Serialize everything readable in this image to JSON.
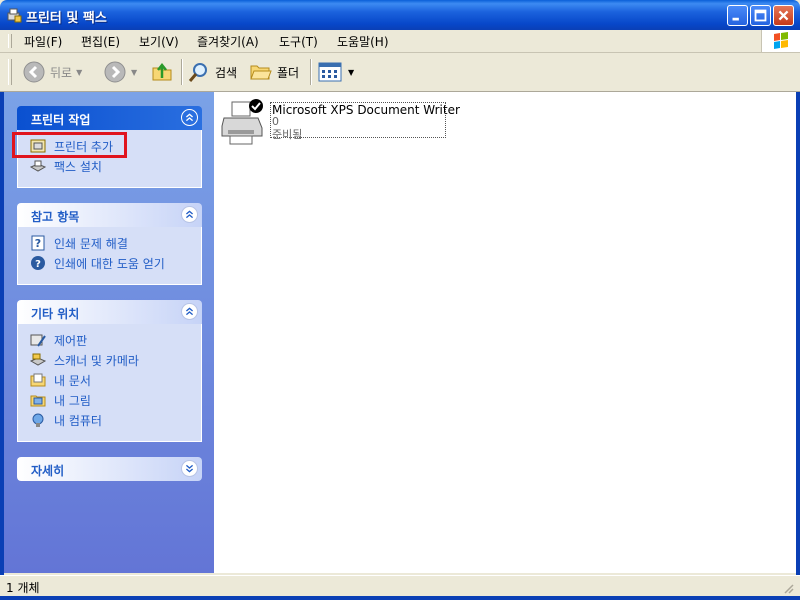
{
  "window": {
    "title": "프린터 및 팩스"
  },
  "menu": {
    "items": [
      "파일(F)",
      "편집(E)",
      "보기(V)",
      "즐겨찾기(A)",
      "도구(T)",
      "도움말(H)"
    ]
  },
  "toolbar": {
    "back": "뒤로",
    "search": "검색",
    "folders": "폴더"
  },
  "task_pane": {
    "printer_tasks": {
      "title": "프린터 작업",
      "items": [
        "프린터 추가",
        "팩스 설치"
      ]
    },
    "see_also": {
      "title": "참고 항목",
      "items": [
        "인쇄 문제 해결",
        "인쇄에 대한 도움 얻기"
      ]
    },
    "other_places": {
      "title": "기타 위치",
      "items": [
        "제어판",
        "스캐너 및 카메라",
        "내 문서",
        "내 그림",
        "내 컴퓨터"
      ]
    },
    "details": {
      "title": "자세히"
    }
  },
  "printer": {
    "name": "Microsoft XPS Document Writer",
    "documents": "0",
    "status": "준비됨"
  },
  "statusbar": {
    "text": "1 개체"
  },
  "colors": {
    "titlebar": "#0a5fd8",
    "taskpane": "#7ba2e7",
    "link": "#215dc6",
    "highlight": "#e0141e"
  }
}
